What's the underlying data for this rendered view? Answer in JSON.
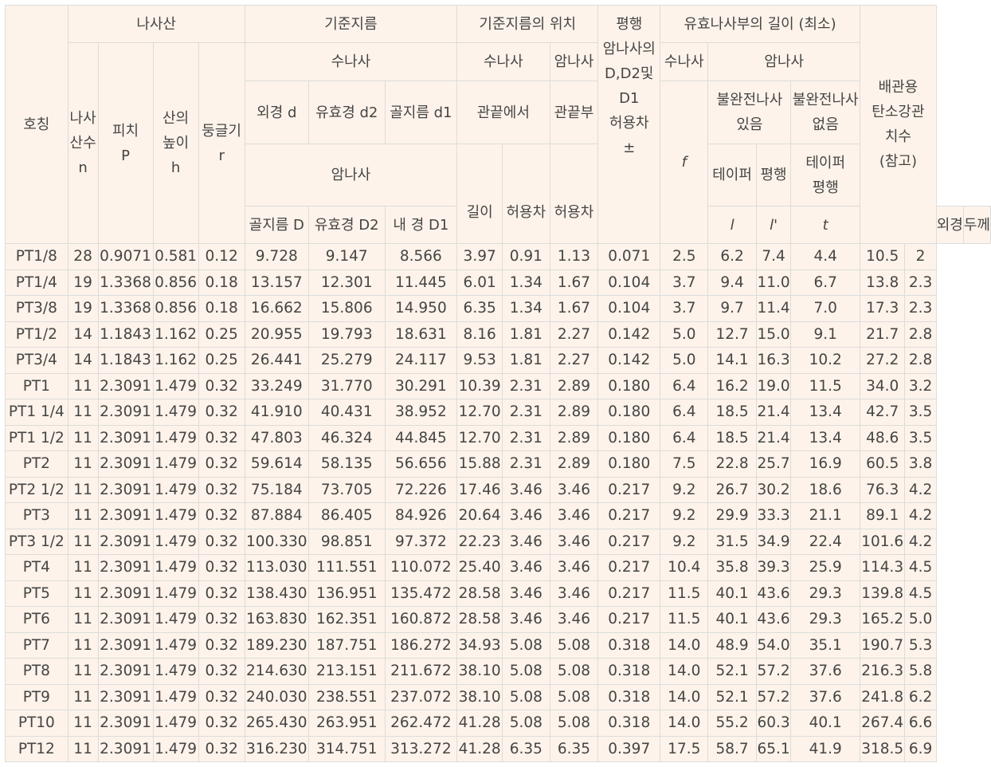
{
  "header": {
    "hoching": "호칭",
    "thread": "나사산",
    "thread_count": "나사\n산수\nn",
    "pitch": "피치\nP",
    "height": "산의\n높이\nh",
    "radius": "둥글기\nr",
    "base_dia": "기준지름",
    "male": "수나사",
    "outer_d": "외경 d",
    "pitch_d2": "유효경 d2",
    "root_d1": "골지름 d1",
    "female": "암나사",
    "root_D": "골지름 D",
    "pitch_D2": "유효경 D2",
    "inner_D1": "내 경 D1",
    "base_pos": "기준지름의 위치",
    "pos_male": "수나사",
    "pos_female": "암나사",
    "from_end": "관끝에서",
    "pipe_end": "관끝부",
    "length": "길이",
    "tol": "허용차",
    "tol2": "허용차",
    "parallel_tol": "평행\n암나사의\nD,D2및\nD1\n허용차\n±",
    "eff_len": "유효나사부의 길이 (최소)",
    "eff_male": "수나사",
    "eff_female": "암나사",
    "incomplete_yes": "불완전나사\n있음",
    "incomplete_no": "불완전나사\n없음",
    "taper": "테이퍼",
    "parallel": "평행",
    "taper_parallel": "테이퍼\n평행",
    "f": "f",
    "l": "l",
    "l_prime": "l'",
    "t": "t",
    "pipe_dim": "배관용\n탄소강관\n치수\n(참고)",
    "outer": "외경",
    "thickness": "두께"
  },
  "rows": [
    [
      "PT1/8",
      "28",
      "0.9071",
      "0.581",
      "0.12",
      "9.728",
      "9.147",
      "8.566",
      "3.97",
      "0.91",
      "1.13",
      "0.071",
      "2.5",
      "6.2",
      "7.4",
      "4.4",
      "10.5",
      "2"
    ],
    [
      "PT1/4",
      "19",
      "1.3368",
      "0.856",
      "0.18",
      "13.157",
      "12.301",
      "11.445",
      "6.01",
      "1.34",
      "1.67",
      "0.104",
      "3.7",
      "9.4",
      "11.0",
      "6.7",
      "13.8",
      "2.3"
    ],
    [
      "PT3/8",
      "19",
      "1.3368",
      "0.856",
      "0.18",
      "16.662",
      "15.806",
      "14.950",
      "6.35",
      "1.34",
      "1.67",
      "0.104",
      "3.7",
      "9.7",
      "11.4",
      "7.0",
      "17.3",
      "2.3"
    ],
    [
      "PT1/2",
      "14",
      "1.1843",
      "1.162",
      "0.25",
      "20.955",
      "19.793",
      "18.631",
      "8.16",
      "1.81",
      "2.27",
      "0.142",
      "5.0",
      "12.7",
      "15.0",
      "9.1",
      "21.7",
      "2.8"
    ],
    [
      "PT3/4",
      "14",
      "1.1843",
      "1.162",
      "0.25",
      "26.441",
      "25.279",
      "24.117",
      "9.53",
      "1.81",
      "2.27",
      "0.142",
      "5.0",
      "14.1",
      "16.3",
      "10.2",
      "27.2",
      "2.8"
    ],
    [
      "PT1",
      "11",
      "2.3091",
      "1.479",
      "0.32",
      "33.249",
      "31.770",
      "30.291",
      "10.39",
      "2.31",
      "2.89",
      "0.180",
      "6.4",
      "16.2",
      "19.0",
      "11.5",
      "34.0",
      "3.2"
    ],
    [
      "PT1 1/4",
      "11",
      "2.3091",
      "1.479",
      "0.32",
      "41.910",
      "40.431",
      "38.952",
      "12.70",
      "2.31",
      "2.89",
      "0.180",
      "6.4",
      "18.5",
      "21.4",
      "13.4",
      "42.7",
      "3.5"
    ],
    [
      "PT1 1/2",
      "11",
      "2.3091",
      "1.479",
      "0.32",
      "47.803",
      "46.324",
      "44.845",
      "12.70",
      "2.31",
      "2.89",
      "0.180",
      "6.4",
      "18.5",
      "21.4",
      "13.4",
      "48.6",
      "3.5"
    ],
    [
      "PT2",
      "11",
      "2.3091",
      "1.479",
      "0.32",
      "59.614",
      "58.135",
      "56.656",
      "15.88",
      "2.31",
      "2.89",
      "0.180",
      "7.5",
      "22.8",
      "25.7",
      "16.9",
      "60.5",
      "3.8"
    ],
    [
      "PT2 1/2",
      "11",
      "2.3091",
      "1.479",
      "0.32",
      "75.184",
      "73.705",
      "72.226",
      "17.46",
      "3.46",
      "3.46",
      "0.217",
      "9.2",
      "26.7",
      "30.2",
      "18.6",
      "76.3",
      "4.2"
    ],
    [
      "PT3",
      "11",
      "2.3091",
      "1.479",
      "0.32",
      "87.884",
      "86.405",
      "84.926",
      "20.64",
      "3.46",
      "3.46",
      "0.217",
      "9.2",
      "29.9",
      "33.3",
      "21.1",
      "89.1",
      "4.2"
    ],
    [
      "PT3 1/2",
      "11",
      "2.3091",
      "1.479",
      "0.32",
      "100.330",
      "98.851",
      "97.372",
      "22.23",
      "3.46",
      "3.46",
      "0.217",
      "9.2",
      "31.5",
      "34.9",
      "22.4",
      "101.6",
      "4.2"
    ],
    [
      "PT4",
      "11",
      "2.3091",
      "1.479",
      "0.32",
      "113.030",
      "111.551",
      "110.072",
      "25.40",
      "3.46",
      "3.46",
      "0.217",
      "10.4",
      "35.8",
      "39.3",
      "25.9",
      "114.3",
      "4.5"
    ],
    [
      "PT5",
      "11",
      "2.3091",
      "1.479",
      "0.32",
      "138.430",
      "136.951",
      "135.472",
      "28.58",
      "3.46",
      "3.46",
      "0.217",
      "11.5",
      "40.1",
      "43.6",
      "29.3",
      "139.8",
      "4.5"
    ],
    [
      "PT6",
      "11",
      "2.3091",
      "1.479",
      "0.32",
      "163.830",
      "162.351",
      "160.872",
      "28.58",
      "3.46",
      "3.46",
      "0.217",
      "11.5",
      "40.1",
      "43.6",
      "29.3",
      "165.2",
      "5.0"
    ],
    [
      "PT7",
      "11",
      "2.3091",
      "1.479",
      "0.32",
      "189.230",
      "187.751",
      "186.272",
      "34.93",
      "5.08",
      "5.08",
      "0.318",
      "14.0",
      "48.9",
      "54.0",
      "35.1",
      "190.7",
      "5.3"
    ],
    [
      "PT8",
      "11",
      "2.3091",
      "1.479",
      "0.32",
      "214.630",
      "213.151",
      "211.672",
      "38.10",
      "5.08",
      "5.08",
      "0.318",
      "14.0",
      "52.1",
      "57.2",
      "37.6",
      "216.3",
      "5.8"
    ],
    [
      "PT9",
      "11",
      "2.3091",
      "1.479",
      "0.32",
      "240.030",
      "238.551",
      "237.072",
      "38.10",
      "5.08",
      "5.08",
      "0.318",
      "14.0",
      "52.1",
      "57.2",
      "37.6",
      "241.8",
      "6.2"
    ],
    [
      "PT10",
      "11",
      "2.3091",
      "1.479",
      "0.32",
      "265.430",
      "263.951",
      "262.472",
      "41.28",
      "5.08",
      "5.08",
      "0.318",
      "14.0",
      "55.2",
      "60.3",
      "40.1",
      "267.4",
      "6.6"
    ],
    [
      "PT12",
      "11",
      "2.3091",
      "1.479",
      "0.32",
      "316.230",
      "314.751",
      "313.272",
      "41.28",
      "6.35",
      "6.35",
      "0.397",
      "17.5",
      "58.7",
      "65.1",
      "41.9",
      "318.5",
      "6.9"
    ]
  ]
}
